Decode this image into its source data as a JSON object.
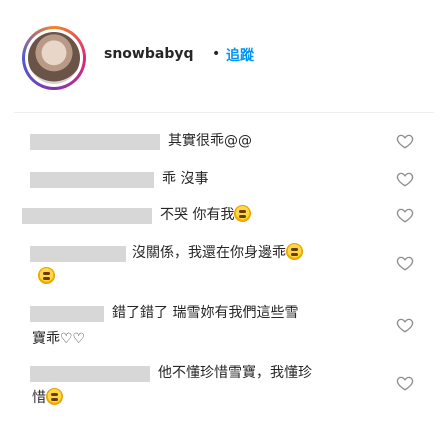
{
  "header": {
    "username": "snowbabyq",
    "separator": "•",
    "follow_label": "追蹤"
  },
  "comments": [
    {
      "text": "其實很乖@@",
      "emoji": false,
      "second_line": ""
    },
    {
      "text": "乖 沒事",
      "emoji": false,
      "second_line": ""
    },
    {
      "text": "不哭 你有我",
      "emoji": true,
      "second_line": ""
    },
    {
      "text": "沒關係，我還在你身邊乖",
      "emoji": true,
      "second_line": ""
    },
    {
      "text": "錯了錯了 瑞雪妳有我們這些雪",
      "emoji": false,
      "second_line": "寶乖♡♡"
    },
    {
      "text": "他不懂珍惜雪寶，我懂珍",
      "emoji": false,
      "second_line": "惜"
    }
  ],
  "icons": {
    "like": "heart-outline-icon",
    "emoji": "laughing-emoji-icon"
  },
  "colors": {
    "follow": "#0095f6",
    "redaction": "#d7d7d7",
    "text": "#262626",
    "heart": "#8e8e8e"
  }
}
